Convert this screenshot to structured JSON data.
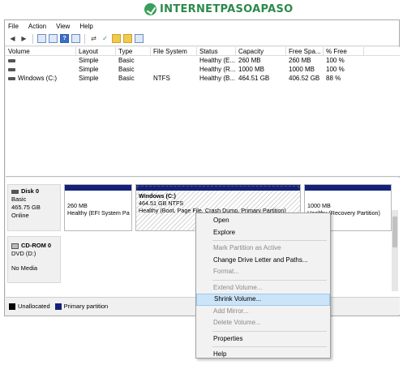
{
  "watermark": {
    "text": "INTERNETPASOAPASO"
  },
  "menu": {
    "file": "File",
    "action": "Action",
    "view": "View",
    "help": "Help"
  },
  "toolbar": {
    "back_icon": "arrow-left-icon",
    "forward_icon": "arrow-right-icon",
    "help_label": "?"
  },
  "volumes": {
    "headers": [
      "Volume",
      "Layout",
      "Type",
      "File System",
      "Status",
      "Capacity",
      "Free Spa...",
      "% Free"
    ],
    "rows": [
      {
        "volume": "",
        "layout": "Simple",
        "type": "Basic",
        "fs": "",
        "status": "Healthy (E...",
        "capacity": "260 MB",
        "free": "260 MB",
        "pct": "100 %"
      },
      {
        "volume": "",
        "layout": "Simple",
        "type": "Basic",
        "fs": "",
        "status": "Healthy (R...",
        "capacity": "1000 MB",
        "free": "1000 MB",
        "pct": "100 %"
      },
      {
        "volume": "Windows (C:)",
        "layout": "Simple",
        "type": "Basic",
        "fs": "NTFS",
        "status": "Healthy (B...",
        "capacity": "464.51 GB",
        "free": "406.52 GB",
        "pct": "88 %"
      }
    ]
  },
  "disks": {
    "disk0": {
      "name": "Disk 0",
      "type": "Basic",
      "size": "465.75 GB",
      "state": "Online",
      "partitions": [
        {
          "title": "",
          "line1": "260 MB",
          "line2": "Healthy (EFI System Pa"
        },
        {
          "title": "Windows  (C:)",
          "line1": "464.51 GB NTFS",
          "line2": "Healthy (Boot, Page File, Crash Dump, Primary Partition)"
        },
        {
          "title": "",
          "line1": "1000 MB",
          "line2": "Healthy (Recovery Partition)"
        }
      ]
    },
    "cdrom0": {
      "name": "CD-ROM 0",
      "drive": "DVD (D:)",
      "media": "No Media"
    }
  },
  "legend": {
    "unallocated": "Unallocated",
    "primary": "Primary partition",
    "unallocated_color": "#000000",
    "primary_color": "#14217a"
  },
  "context_menu": {
    "items": [
      {
        "label": "Open",
        "enabled": true
      },
      {
        "label": "Explore",
        "enabled": true
      },
      {
        "label": "Mark Partition as Active",
        "enabled": false
      },
      {
        "label": "Change Drive Letter and Paths...",
        "enabled": true
      },
      {
        "label": "Format...",
        "enabled": false
      },
      {
        "label": "Extend Volume...",
        "enabled": false
      },
      {
        "label": "Shrink Volume...",
        "enabled": true,
        "highlighted": true
      },
      {
        "label": "Add Mirror...",
        "enabled": false
      },
      {
        "label": "Delete Volume...",
        "enabled": false
      },
      {
        "label": "Properties",
        "enabled": true
      },
      {
        "label": "Help",
        "enabled": true
      }
    ]
  }
}
